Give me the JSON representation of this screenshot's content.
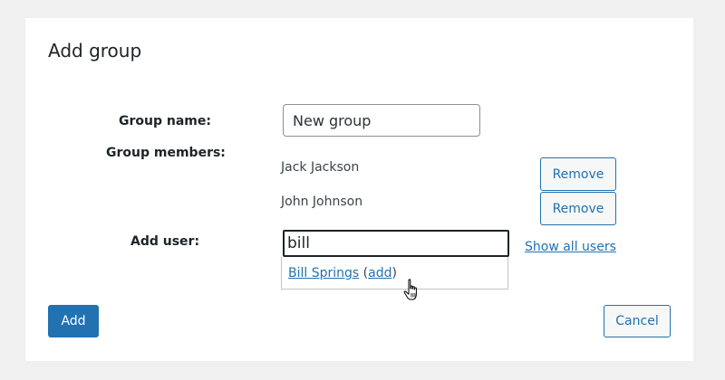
{
  "dialog": {
    "title": "Add group"
  },
  "form": {
    "group_name_label": "Group name:",
    "group_name_value": "New group",
    "group_members_label": "Group members:",
    "members": [
      {
        "name": "Jack Jackson",
        "remove_label": "Remove"
      },
      {
        "name": "John Johnson",
        "remove_label": "Remove"
      }
    ],
    "add_user_label": "Add user:",
    "add_user_value": "bill",
    "show_all_label": "Show all users",
    "suggestion": {
      "name": "Bill Springs",
      "open_paren": " (",
      "action": "add",
      "close_paren": ")"
    }
  },
  "footer": {
    "add_label": "Add",
    "cancel_label": "Cancel"
  },
  "icons": {
    "cursor": "hand-pointer-icon"
  },
  "colors": {
    "accent": "#2271b1",
    "background": "#f0f0f1",
    "text": "#1d2327"
  }
}
